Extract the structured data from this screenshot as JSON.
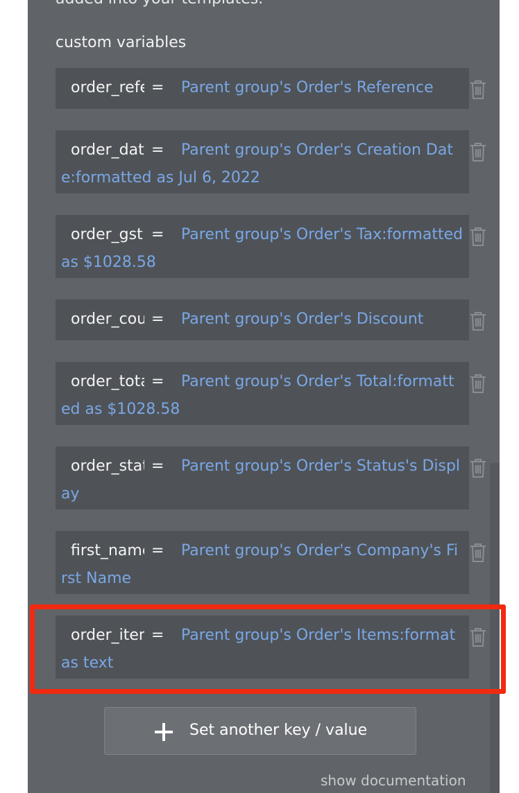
{
  "panel": {
    "top_cut_text": "added into your templates.",
    "section_label": "custom variables"
  },
  "variables": [
    {
      "key": "order_reference",
      "value": "Parent group's Order's Reference"
    },
    {
      "key": "order_date",
      "value": "Parent group's Order's Creation Date:formatted as Jul 6, 2022"
    },
    {
      "key": "order_gst",
      "value": "Parent group's Order's Tax:formatted as $1028.58"
    },
    {
      "key": "order_coupon",
      "value": "Parent group's Order's Discount"
    },
    {
      "key": "order_total",
      "value": "Parent group's Order's Total:formatted as $1028.58"
    },
    {
      "key": "order_status",
      "value": "Parent group's Order's Status's Display"
    },
    {
      "key": "first_name",
      "value": "Parent group's Order's Company's First Name"
    },
    {
      "key": "order_items",
      "value": "Parent group's Order's Items:format as text"
    }
  ],
  "equals_sign": "=",
  "add_button": {
    "label": "Set another key / value",
    "icon": "plus-icon"
  },
  "show_documentation": "show documentation",
  "row_icon": "trash-icon",
  "colors": {
    "panel_bg": "#606468",
    "row_bg": "#4f5357",
    "value_text": "#7aa7e6",
    "highlight": "#f02a10"
  }
}
